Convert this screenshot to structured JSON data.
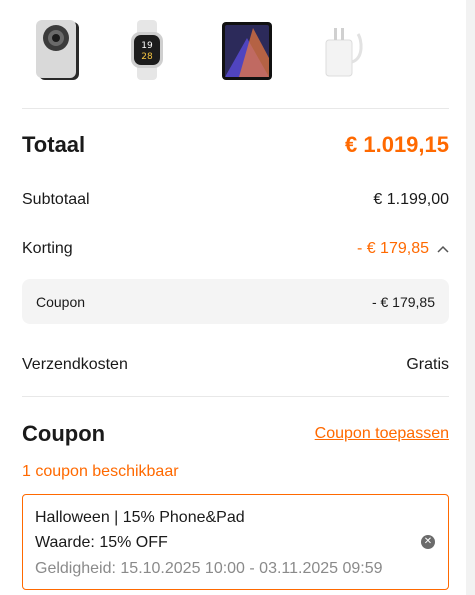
{
  "products": [
    {
      "name": "phone-thumbnail"
    },
    {
      "name": "watch-thumbnail"
    },
    {
      "name": "tablet-thumbnail"
    },
    {
      "name": "charger-thumbnail"
    }
  ],
  "summary": {
    "total_label": "Totaal",
    "total_value": "€ 1.019,15",
    "subtotal_label": "Subtotaal",
    "subtotal_value": "€ 1.199,00",
    "discount_label": "Korting",
    "discount_value": "- € 179,85",
    "discount_toggle_icon": "chevron-up-icon",
    "coupon_label": "Coupon",
    "coupon_value": "- € 179,85",
    "shipping_label": "Verzendkosten",
    "shipping_value": "Gratis"
  },
  "coupon_section": {
    "title": "Coupon",
    "apply_link": "Coupon toepassen",
    "available_text": "1 coupon beschikbaar",
    "card": {
      "name": "Halloween | 15% Phone&Pad",
      "value": "Waarde: 15% OFF",
      "validity": "Geldigheid: 15.10.2025 10:00 - 03.11.2025 09:59",
      "remove_icon": "close-circle-icon"
    }
  },
  "colors": {
    "accent": "#ff6900",
    "text": "#1a1a1a",
    "muted": "#8a8a8a",
    "box_bg": "#f4f4f4"
  }
}
